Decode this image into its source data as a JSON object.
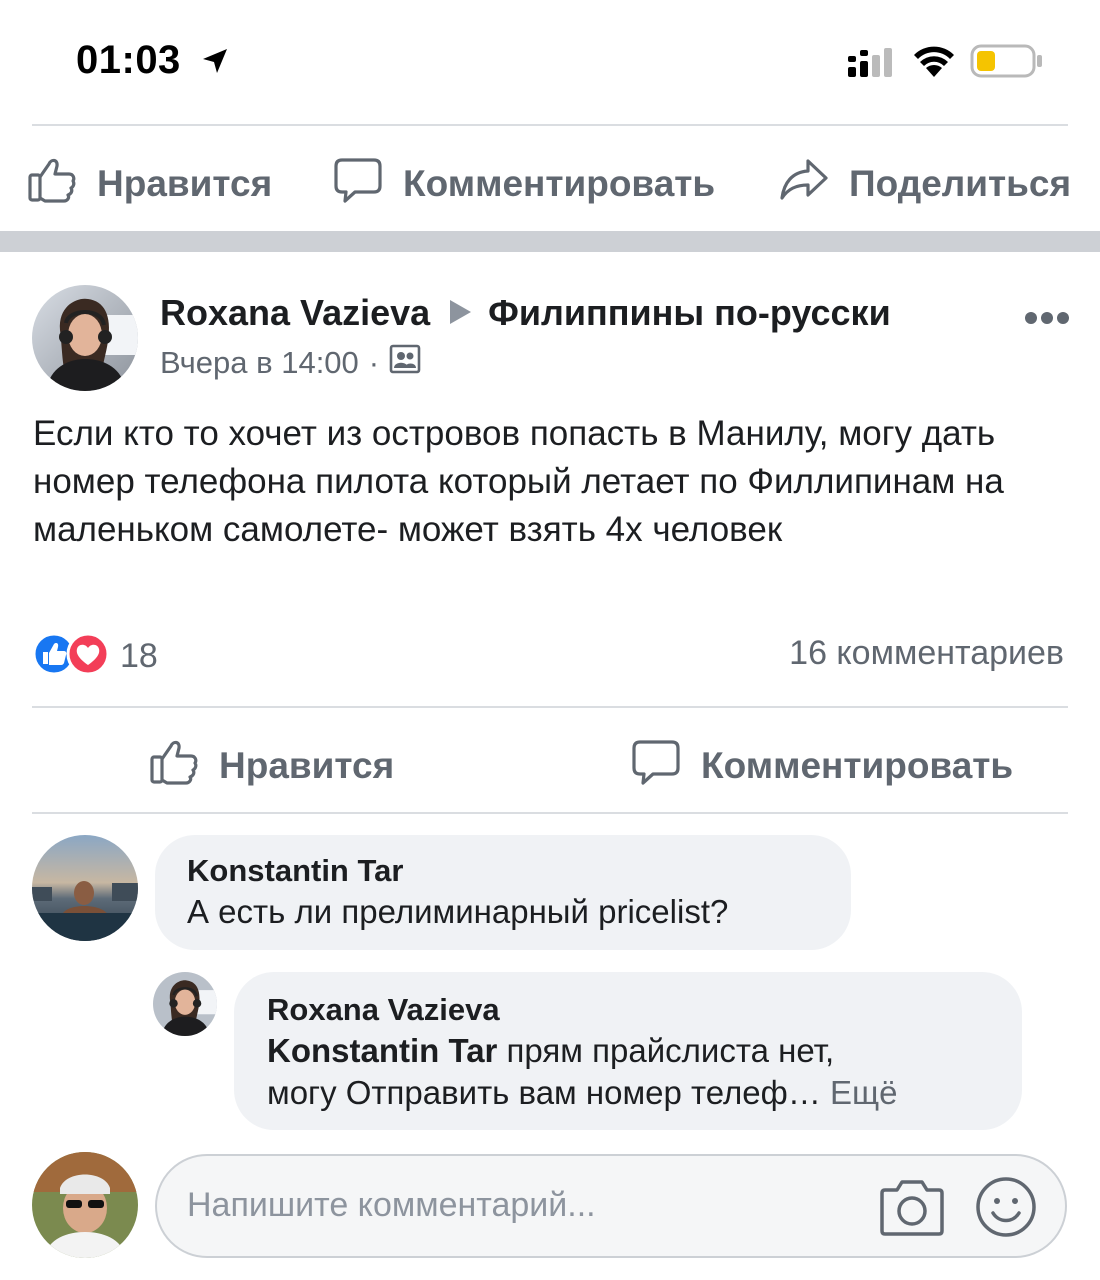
{
  "status_bar": {
    "time": "01:03",
    "icons": [
      "location-arrow-icon",
      "cellular-signal-icon",
      "wifi-icon",
      "battery-low-icon"
    ],
    "battery_color": "#f5c400"
  },
  "prev_post_actions": {
    "like_label": "Нравится",
    "comment_label": "Комментировать",
    "share_label": "Поделиться"
  },
  "post": {
    "author": "Roxana Vazieva",
    "group": "Филиппины по-русски",
    "timestamp": "Вчера в 14:00",
    "separator": "·",
    "text": "Если кто то хочет из островов попасть в Манилу, могу дать номер телефона пилота который летает по Филлипинам на маленьком самолете- может взять 4х человек",
    "reaction_count": "18",
    "comments_count": "16 комментариев",
    "reactions": [
      "like-reaction-icon",
      "love-reaction-icon"
    ]
  },
  "post_actions": {
    "like_label": "Нравится",
    "comment_label": "Комментировать"
  },
  "comments": [
    {
      "author": "Konstantin Tar",
      "text": "А есть ли прелиминарный pricelist?"
    },
    {
      "author": "Roxana Vazieva",
      "mention": "Konstantin Tar",
      "text_line1": " прям прайслиста нет,",
      "text_line2": "могу Отправить вам номер телеф…",
      "more_label": "Ещё"
    }
  ],
  "comment_input": {
    "placeholder": "Напишите комментарий..."
  },
  "colors": {
    "accent_blue": "#1877f2",
    "love_red": "#f33e58",
    "secondary_text": "#606770",
    "bubble_bg": "#f0f2f5"
  }
}
